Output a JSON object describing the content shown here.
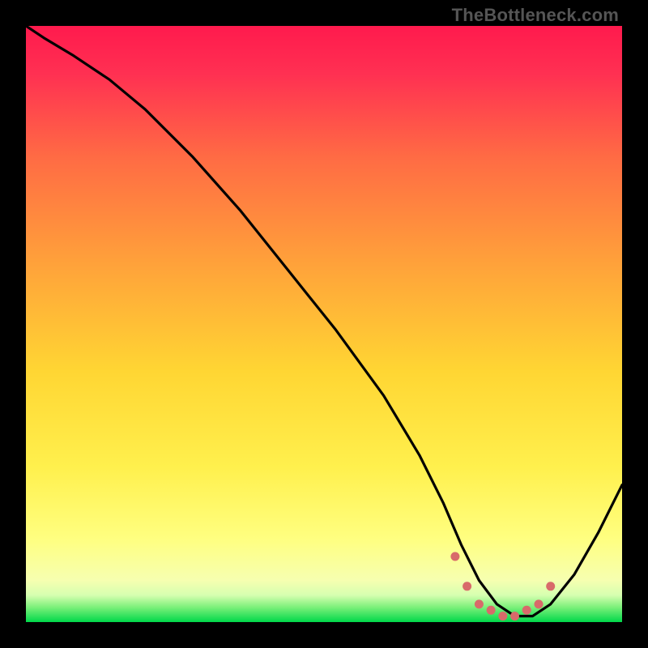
{
  "watermark": "TheBottleneck.com",
  "colors": {
    "top": "#ff1a4d",
    "upper_mid": "#ff7a3d",
    "mid": "#ffd633",
    "lower_mid": "#ffff66",
    "low": "#f3ffb3",
    "bottom_yellow": "#f8ffb8",
    "bottom_green": "#00e24d",
    "curve": "#000000",
    "dots": "#d86a6a",
    "background": "#000000"
  },
  "chart_data": {
    "type": "line",
    "title": "",
    "xlabel": "",
    "ylabel": "",
    "xlim": [
      0,
      100
    ],
    "ylim": [
      0,
      100
    ],
    "series": [
      {
        "name": "bottleneck-curve",
        "x": [
          0,
          3,
          8,
          14,
          20,
          28,
          36,
          44,
          52,
          60,
          66,
          70,
          73,
          76,
          79,
          82,
          85,
          88,
          92,
          96,
          100
        ],
        "y": [
          100,
          98,
          95,
          91,
          86,
          78,
          69,
          59,
          49,
          38,
          28,
          20,
          13,
          7,
          3,
          1,
          1,
          3,
          8,
          15,
          23
        ]
      }
    ],
    "highlight_dots": {
      "name": "flat-region-markers",
      "x": [
        72,
        74,
        76,
        78,
        80,
        82,
        84,
        86,
        88
      ],
      "y": [
        11,
        6,
        3,
        2,
        1,
        1,
        2,
        3,
        6
      ]
    }
  }
}
